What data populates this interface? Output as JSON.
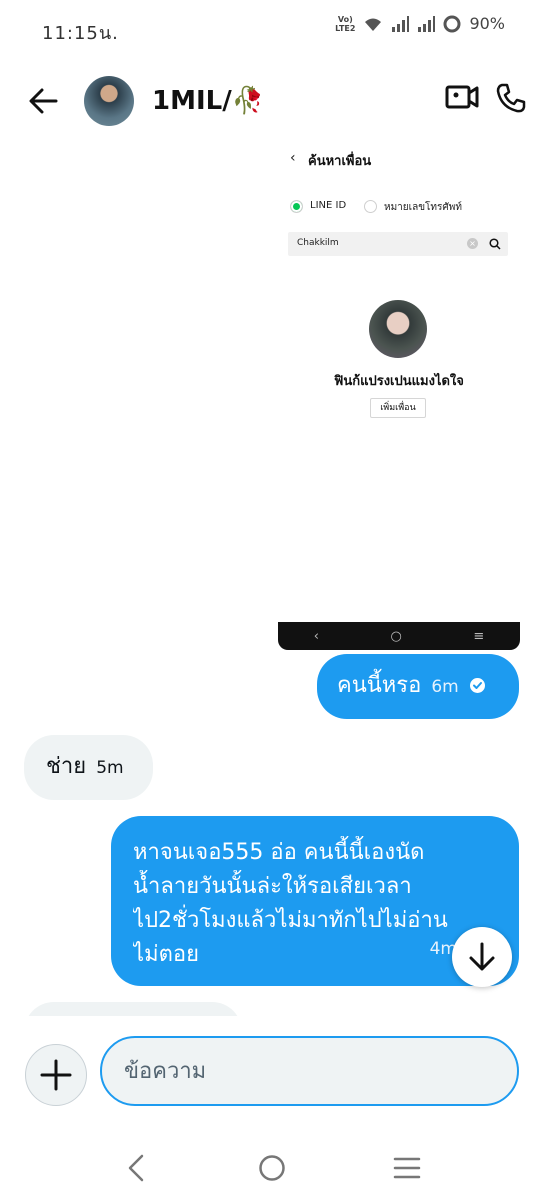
{
  "status_bar": {
    "time": "11:15น.",
    "network_label": "VoLTE2",
    "battery": "90%"
  },
  "header": {
    "back_icon": "arrow-left-icon",
    "contact_name": "1MIL/🥀",
    "video_icon": "video-camera-icon",
    "call_icon": "phone-icon"
  },
  "shared_image": {
    "title": "ค้นหาเพื่อน",
    "options": [
      "LINE ID",
      "หมายเลขโทรศัพท์"
    ],
    "search_value": "Chakkilm",
    "profile_name": "ฟินก้แปรงเปนแมงไดใจ",
    "add_button": "เพิ่มเพื่อน"
  },
  "messages": [
    {
      "direction": "outgoing",
      "text": "คนนี้หรอ",
      "time": "6m",
      "status": "read"
    },
    {
      "direction": "incoming",
      "text": "ช่าย",
      "time": "5m"
    },
    {
      "direction": "outgoing",
      "lines": [
        "หาจนเจอ555 อ่อ คนนี้นี้เองนัด",
        "น้ำลายวันนั้นล่ะให้รอเสียเวลา",
        "ไป2ชั่วโมงแล้วไม่มาทักไปไม่อ่าน",
        "ไม่ตอย"
      ],
      "time": "4m"
    }
  ],
  "composer": {
    "placeholder": "ข้อความ",
    "add_icon": "plus-icon"
  },
  "colors": {
    "accent": "#1d9bf0",
    "incoming_bubble": "#eff3f4",
    "line_green": "#06c755"
  }
}
